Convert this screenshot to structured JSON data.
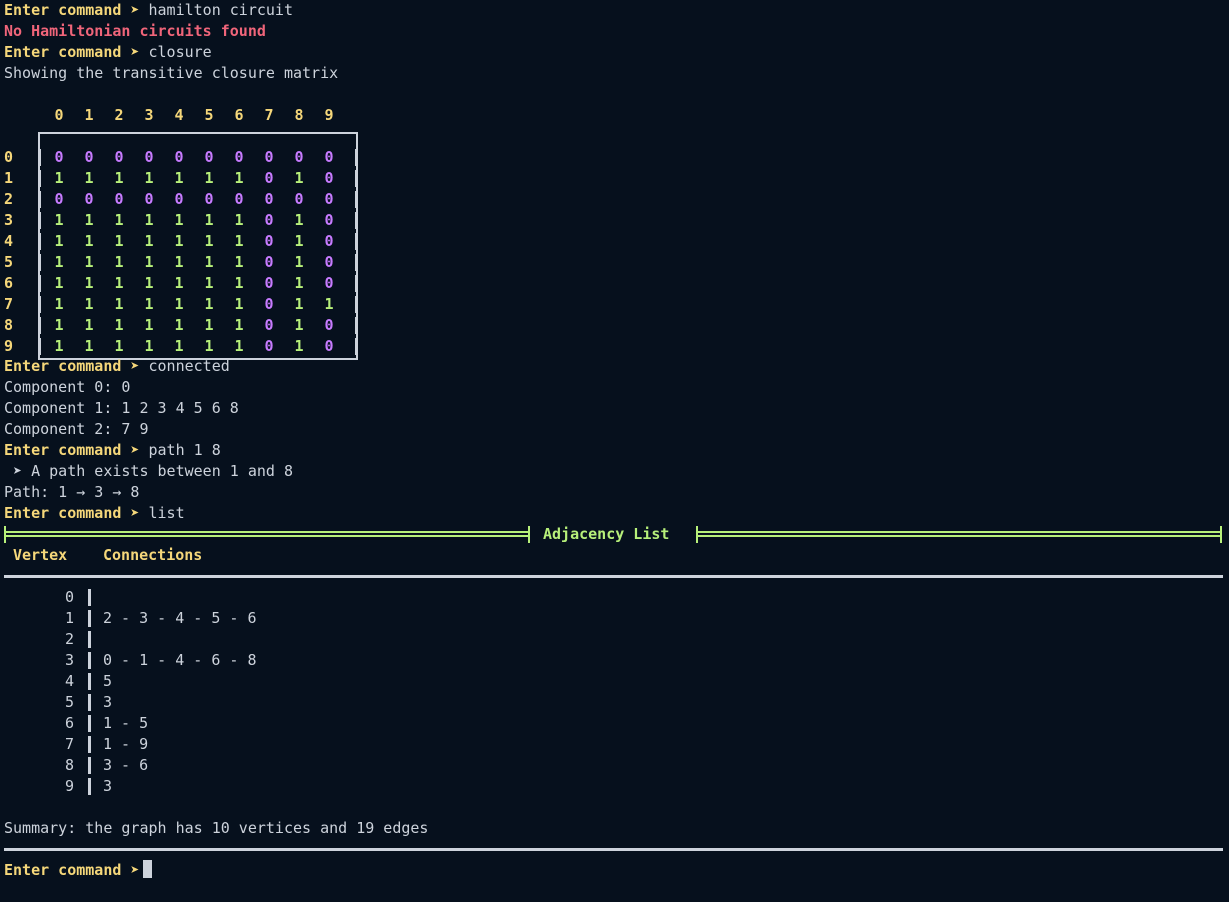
{
  "prompt": "Enter command ➤",
  "history": {
    "cmd1": "hamilton circuit",
    "err1": "No Hamiltonian circuits found",
    "cmd2": "closure",
    "out2": "Showing the transitive closure matrix",
    "cmd3": "connected",
    "components": [
      "Component 0: 0",
      "Component 1: 1 2 3 4 5 6 8",
      "Component 2: 7 9"
    ],
    "cmd4": "path 1 8",
    "path_msg": " ➤ A path exists between 1 and 8",
    "path": "Path: 1 → 3 → 8",
    "cmd5": "list"
  },
  "matrix": {
    "cols": [
      "0",
      "1",
      "2",
      "3",
      "4",
      "5",
      "6",
      "7",
      "8",
      "9"
    ],
    "rows": [
      {
        "label": "0",
        "vals": [
          "0",
          "0",
          "0",
          "0",
          "0",
          "0",
          "0",
          "0",
          "0",
          "0"
        ]
      },
      {
        "label": "1",
        "vals": [
          "1",
          "1",
          "1",
          "1",
          "1",
          "1",
          "1",
          "0",
          "1",
          "0"
        ]
      },
      {
        "label": "2",
        "vals": [
          "0",
          "0",
          "0",
          "0",
          "0",
          "0",
          "0",
          "0",
          "0",
          "0"
        ]
      },
      {
        "label": "3",
        "vals": [
          "1",
          "1",
          "1",
          "1",
          "1",
          "1",
          "1",
          "0",
          "1",
          "0"
        ]
      },
      {
        "label": "4",
        "vals": [
          "1",
          "1",
          "1",
          "1",
          "1",
          "1",
          "1",
          "0",
          "1",
          "0"
        ]
      },
      {
        "label": "5",
        "vals": [
          "1",
          "1",
          "1",
          "1",
          "1",
          "1",
          "1",
          "0",
          "1",
          "0"
        ]
      },
      {
        "label": "6",
        "vals": [
          "1",
          "1",
          "1",
          "1",
          "1",
          "1",
          "1",
          "0",
          "1",
          "0"
        ]
      },
      {
        "label": "7",
        "vals": [
          "1",
          "1",
          "1",
          "1",
          "1",
          "1",
          "1",
          "0",
          "1",
          "1"
        ]
      },
      {
        "label": "8",
        "vals": [
          "1",
          "1",
          "1",
          "1",
          "1",
          "1",
          "1",
          "0",
          "1",
          "0"
        ]
      },
      {
        "label": "9",
        "vals": [
          "1",
          "1",
          "1",
          "1",
          "1",
          "1",
          "1",
          "0",
          "1",
          "0"
        ]
      }
    ]
  },
  "adjacency": {
    "title": "Adjacency List",
    "col_vertex": "Vertex",
    "col_connections": "Connections",
    "rows": [
      {
        "v": "0",
        "c": ""
      },
      {
        "v": "1",
        "c": "2 - 3 - 4 - 5 - 6"
      },
      {
        "v": "2",
        "c": ""
      },
      {
        "v": "3",
        "c": "0 - 1 - 4 - 6 - 8"
      },
      {
        "v": "4",
        "c": "5"
      },
      {
        "v": "5",
        "c": "3"
      },
      {
        "v": "6",
        "c": "1 - 5"
      },
      {
        "v": "7",
        "c": "1 - 9"
      },
      {
        "v": "8",
        "c": "3 - 6"
      },
      {
        "v": "9",
        "c": "3"
      }
    ],
    "summary": "Summary: the graph has 10 vertices and 19 edges"
  },
  "colors": {
    "prompt": "#f5d77a",
    "error": "#f0657a",
    "one": "#b7f07a",
    "zero": "#c77bff",
    "text": "#cdd3dc",
    "background": "#06101d"
  }
}
